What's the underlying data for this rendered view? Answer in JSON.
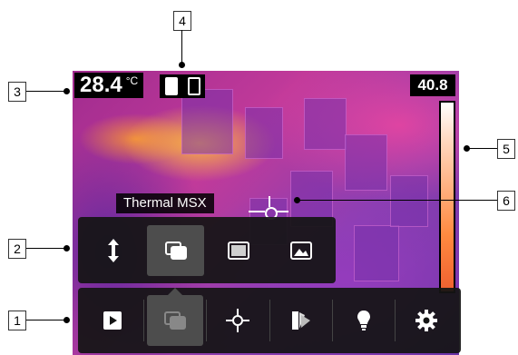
{
  "temperature": {
    "value": "28.4",
    "unit": "°C"
  },
  "max_temperature": "40.8",
  "image_mode_label": "Thermal MSX",
  "submenu": {
    "items": [
      {
        "icon": "up-down-arrow-icon",
        "selected": false
      },
      {
        "icon": "image-mode-overlay-icon",
        "selected": true
      },
      {
        "icon": "thermal-mode-icon",
        "selected": false
      },
      {
        "icon": "digital-camera-mode-icon",
        "selected": false
      }
    ]
  },
  "toolbar": {
    "items": [
      {
        "icon": "play-icon",
        "selected": false
      },
      {
        "icon": "image-mode-icon",
        "selected": true
      },
      {
        "icon": "measurement-crosshair-icon",
        "selected": false
      },
      {
        "icon": "color-palette-icon",
        "selected": false
      },
      {
        "icon": "lamp-icon",
        "selected": false
      },
      {
        "icon": "settings-gear-icon",
        "selected": false
      }
    ]
  },
  "callouts": {
    "c1": "1",
    "c2": "2",
    "c3": "3",
    "c4": "4",
    "c5": "5",
    "c6": "6"
  },
  "colors": {
    "hud_background": "#000000",
    "toolbar_background": "#141414",
    "selected_button": "#4d4d4d"
  }
}
